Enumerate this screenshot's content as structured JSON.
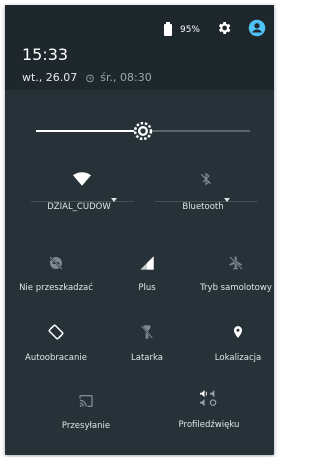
{
  "status": {
    "battery_percent": "95%"
  },
  "header": {
    "time": "15:33",
    "date": "wt., 26.07",
    "alarm": "śr., 08:30"
  },
  "brightness": {
    "level": 0.5
  },
  "tiles": {
    "wifi": "DZIAL_CUDOW",
    "bluetooth": "Bluetooth",
    "dnd": "Nie przeszkadzać",
    "cell": "Plus",
    "airplane": "Tryb samolotowy",
    "rotate": "Autoobracanie",
    "flashlight": "Latarka",
    "location": "Lokalizacja",
    "cast": "Przesyłanie",
    "sound": "Profiledźwięku"
  },
  "colors": {
    "panel": "#263238",
    "header": "#1e272c",
    "accent": "#4fc3f7"
  }
}
